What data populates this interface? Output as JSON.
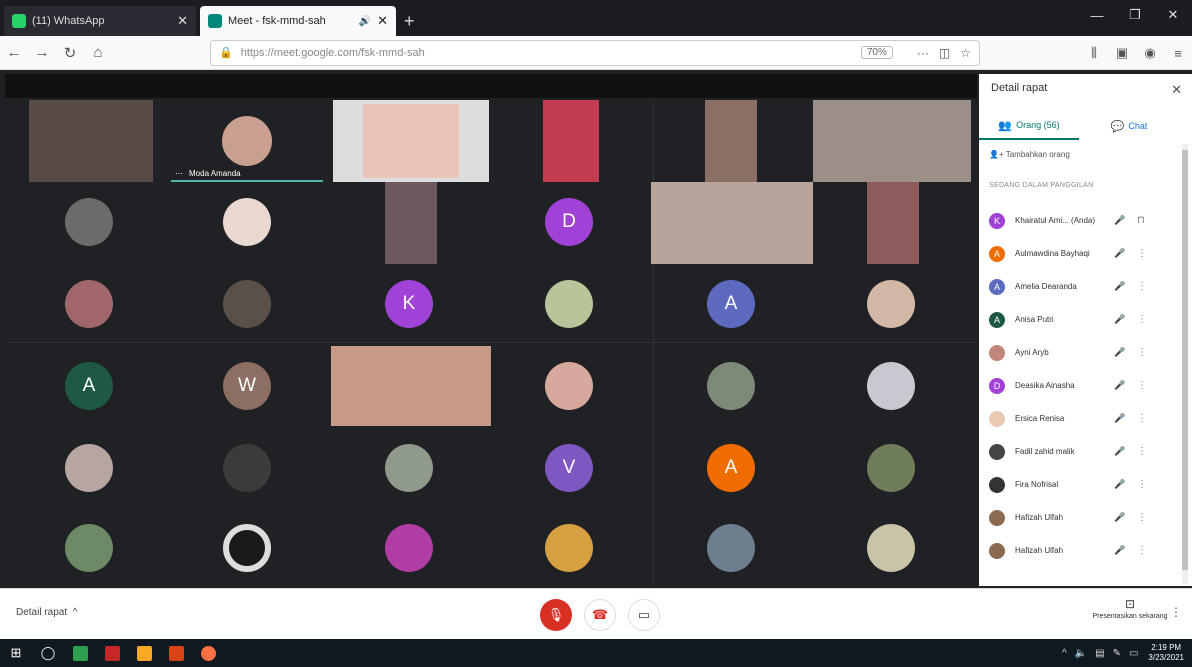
{
  "browser": {
    "tabs": [
      {
        "title": "(11) WhatsApp",
        "icon": "whatsapp-icon",
        "color": "#25d366",
        "active": false
      },
      {
        "title": "Meet - fsk-mmd-sah",
        "icon": "meet-icon",
        "color": "#00897b",
        "active": true
      }
    ],
    "url_text": "https://meet.google.com/fsk-mmd-sah",
    "zoom": "70%"
  },
  "meet": {
    "speaker_name": "Moda Amanda",
    "avatar_letters": [
      "D",
      "K",
      "A",
      "A",
      "W",
      "V",
      "A"
    ],
    "colors": {
      "purple": "#a142d6",
      "blue": "#5c6bc0",
      "green": "#1e5945",
      "brown": "#8d6e63",
      "violet": "#7e57c2",
      "orange": "#ef6c00"
    }
  },
  "panel": {
    "title": "Detail rapat",
    "tab_people": "Orang (56)",
    "tab_chat": "Chat",
    "add_people": "Tambahkan orang",
    "section_heading": "SEDANG DALAM PANGGILAN",
    "participants": [
      {
        "name": "Khairatul Ami... (Anda)",
        "initial": "K",
        "color": "#a142d6"
      },
      {
        "name": "Aulmawdina Bayhaqi",
        "initial": "A",
        "color": "#ef6c00"
      },
      {
        "name": "Amelia Dearanda",
        "initial": "A",
        "color": "#5c6bc0"
      },
      {
        "name": "Anisa Putri",
        "initial": "A",
        "color": "#1e5945"
      },
      {
        "name": "Ayni Aryb",
        "initial": "",
        "color": "#c0877a"
      },
      {
        "name": "Deasika Ainasha",
        "initial": "D",
        "color": "#a142d6"
      },
      {
        "name": "Ersica Renisa",
        "initial": "",
        "color": "#e9c9b0"
      },
      {
        "name": "Fadil zahid malik",
        "initial": "",
        "color": "#444"
      },
      {
        "name": "Fira Nofrisal",
        "initial": "",
        "color": "#333"
      },
      {
        "name": "Hafizah Ulfah",
        "initial": "",
        "color": "#8a6a50"
      },
      {
        "name": "Hafizah Ulfah",
        "initial": "",
        "color": "#8a6a50"
      }
    ]
  },
  "controls": {
    "details_label": "Detail rapat",
    "present_label": "Presentasikan sekarang"
  },
  "taskbar": {
    "time": "2:19 PM",
    "date": "3/23/2021"
  }
}
